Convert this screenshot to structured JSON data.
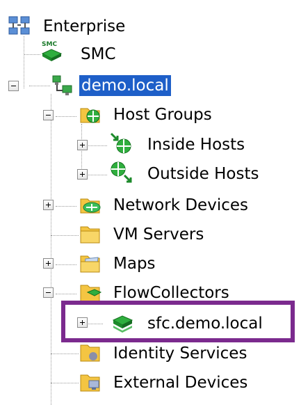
{
  "tree": {
    "enterprise": "Enterprise",
    "smc_badge": "SMC",
    "smc": "SMC",
    "domain": "demo.local",
    "host_groups": "Host Groups",
    "inside_hosts": "Inside Hosts",
    "outside_hosts": "Outside Hosts",
    "network_devices": "Network Devices",
    "vm_servers": "VM Servers",
    "maps": "Maps",
    "flow_collectors": "FlowCollectors",
    "sfc": "sfc.demo.local",
    "identity_services": "Identity Services",
    "external_devices": "External Devices"
  },
  "colors": {
    "selection": "#1e5fc8",
    "highlight_border": "#7b2a8e"
  }
}
